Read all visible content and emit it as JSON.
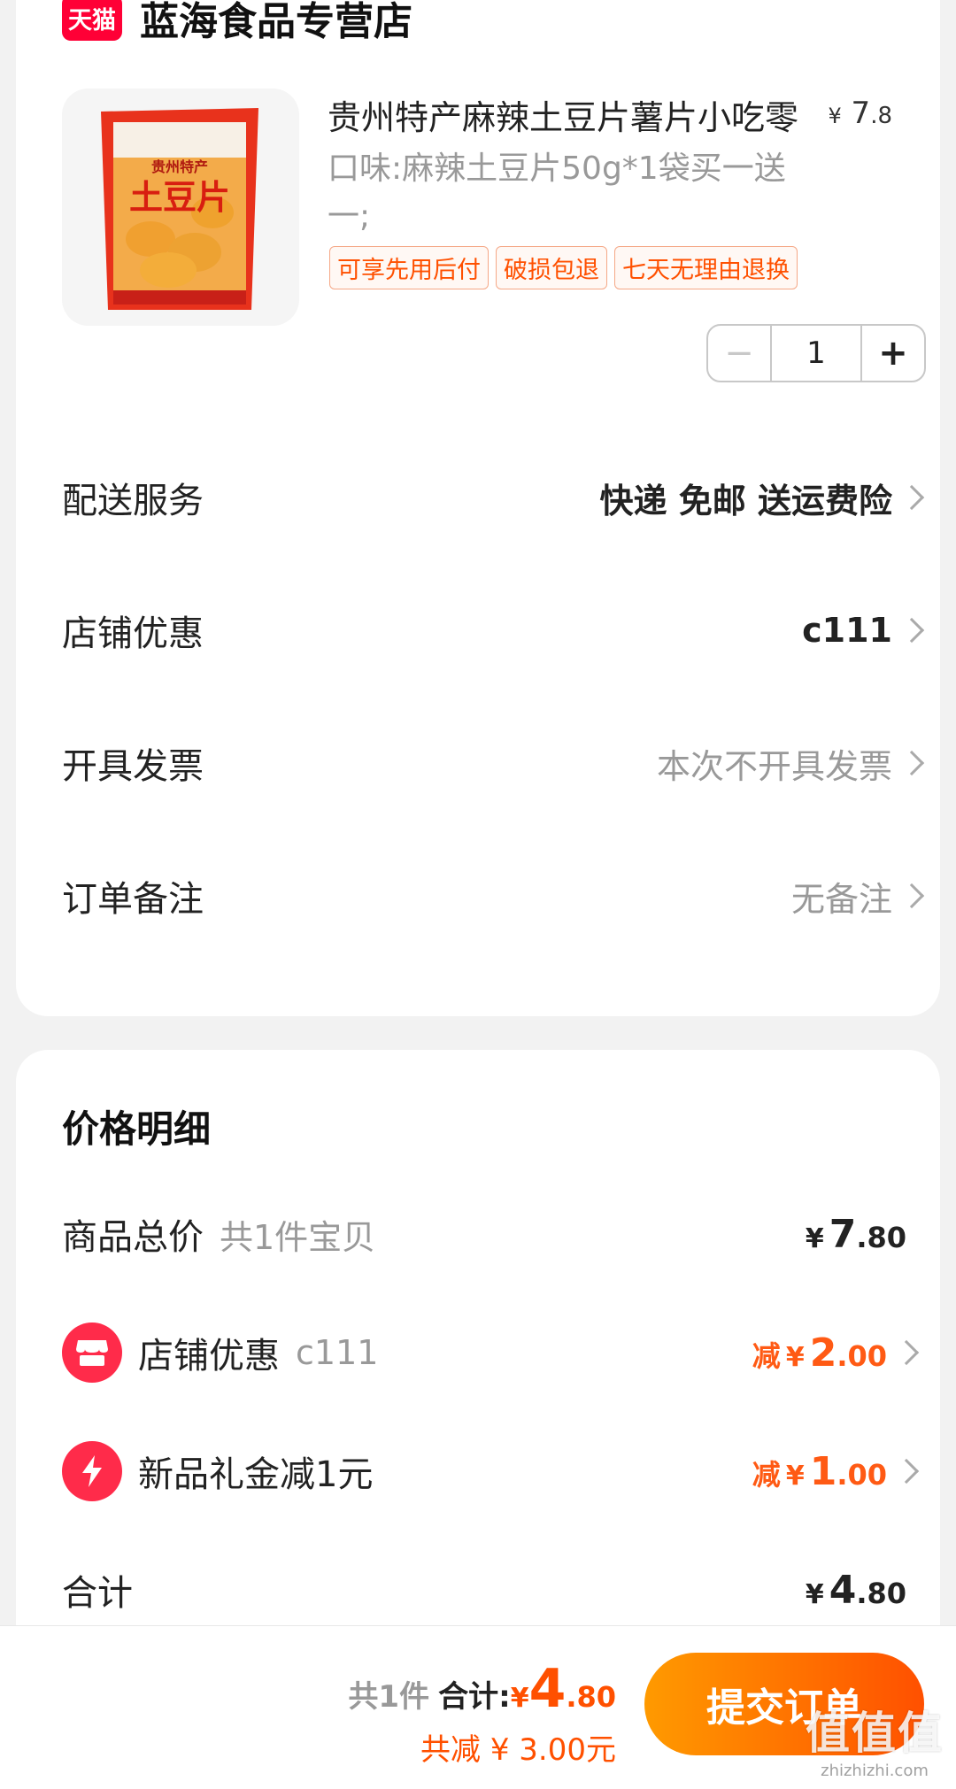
{
  "shop": {
    "badge": "天猫",
    "name": "蓝海食品专营店"
  },
  "product": {
    "name": "贵州特产麻辣土豆片薯片小吃零",
    "price_symbol": "¥",
    "price_int": "7",
    "price_dec": ".8",
    "sku": "口味:麻辣土豆片50g*1袋买一送一;",
    "tags": [
      "可享先用后付",
      "破损包退",
      "七天无理由退换"
    ],
    "package_texts": [
      "贵州特产",
      "土豆片"
    ]
  },
  "stepper": {
    "minus": "−",
    "qty": "1",
    "plus": "+"
  },
  "options": [
    {
      "label": "配送服务",
      "value": "快递 免邮 送运费险",
      "style": "dark"
    },
    {
      "label": "店铺优惠",
      "value": "c111",
      "style": "dark"
    },
    {
      "label": "开具发票",
      "value": "本次不开具发票",
      "style": "grey"
    },
    {
      "label": "订单备注",
      "value": "无备注",
      "style": "grey"
    }
  ],
  "price_detail": {
    "title": "价格明细",
    "goods_total": {
      "label": "商品总价",
      "sub": "共1件宝贝",
      "symbol": "¥",
      "int": "7",
      "dec": ".80"
    },
    "shop_discount": {
      "label": "店铺优惠",
      "sub": "c111",
      "prefix": "减",
      "symbol": "¥",
      "int": "2",
      "dec": ".00"
    },
    "new_gift": {
      "label": "新品礼金减1元",
      "prefix": "减",
      "symbol": "¥",
      "int": "1",
      "dec": ".00"
    },
    "total": {
      "label": "合计",
      "symbol": "¥",
      "int": "4",
      "dec": ".80"
    }
  },
  "bottom_bar": {
    "count": "共1件",
    "total_label": "合计:",
    "symbol": "¥",
    "int": "4",
    "dec": ".80",
    "saved": "共减 ¥ 3.00元",
    "submit": "提交订单"
  },
  "watermark": {
    "main": "值值值",
    "sub": "zhizhizhi.com"
  },
  "colors": {
    "accent": "#ff5000",
    "tmall_red": "#ff0036",
    "discount_orange": "#ff5a14"
  }
}
